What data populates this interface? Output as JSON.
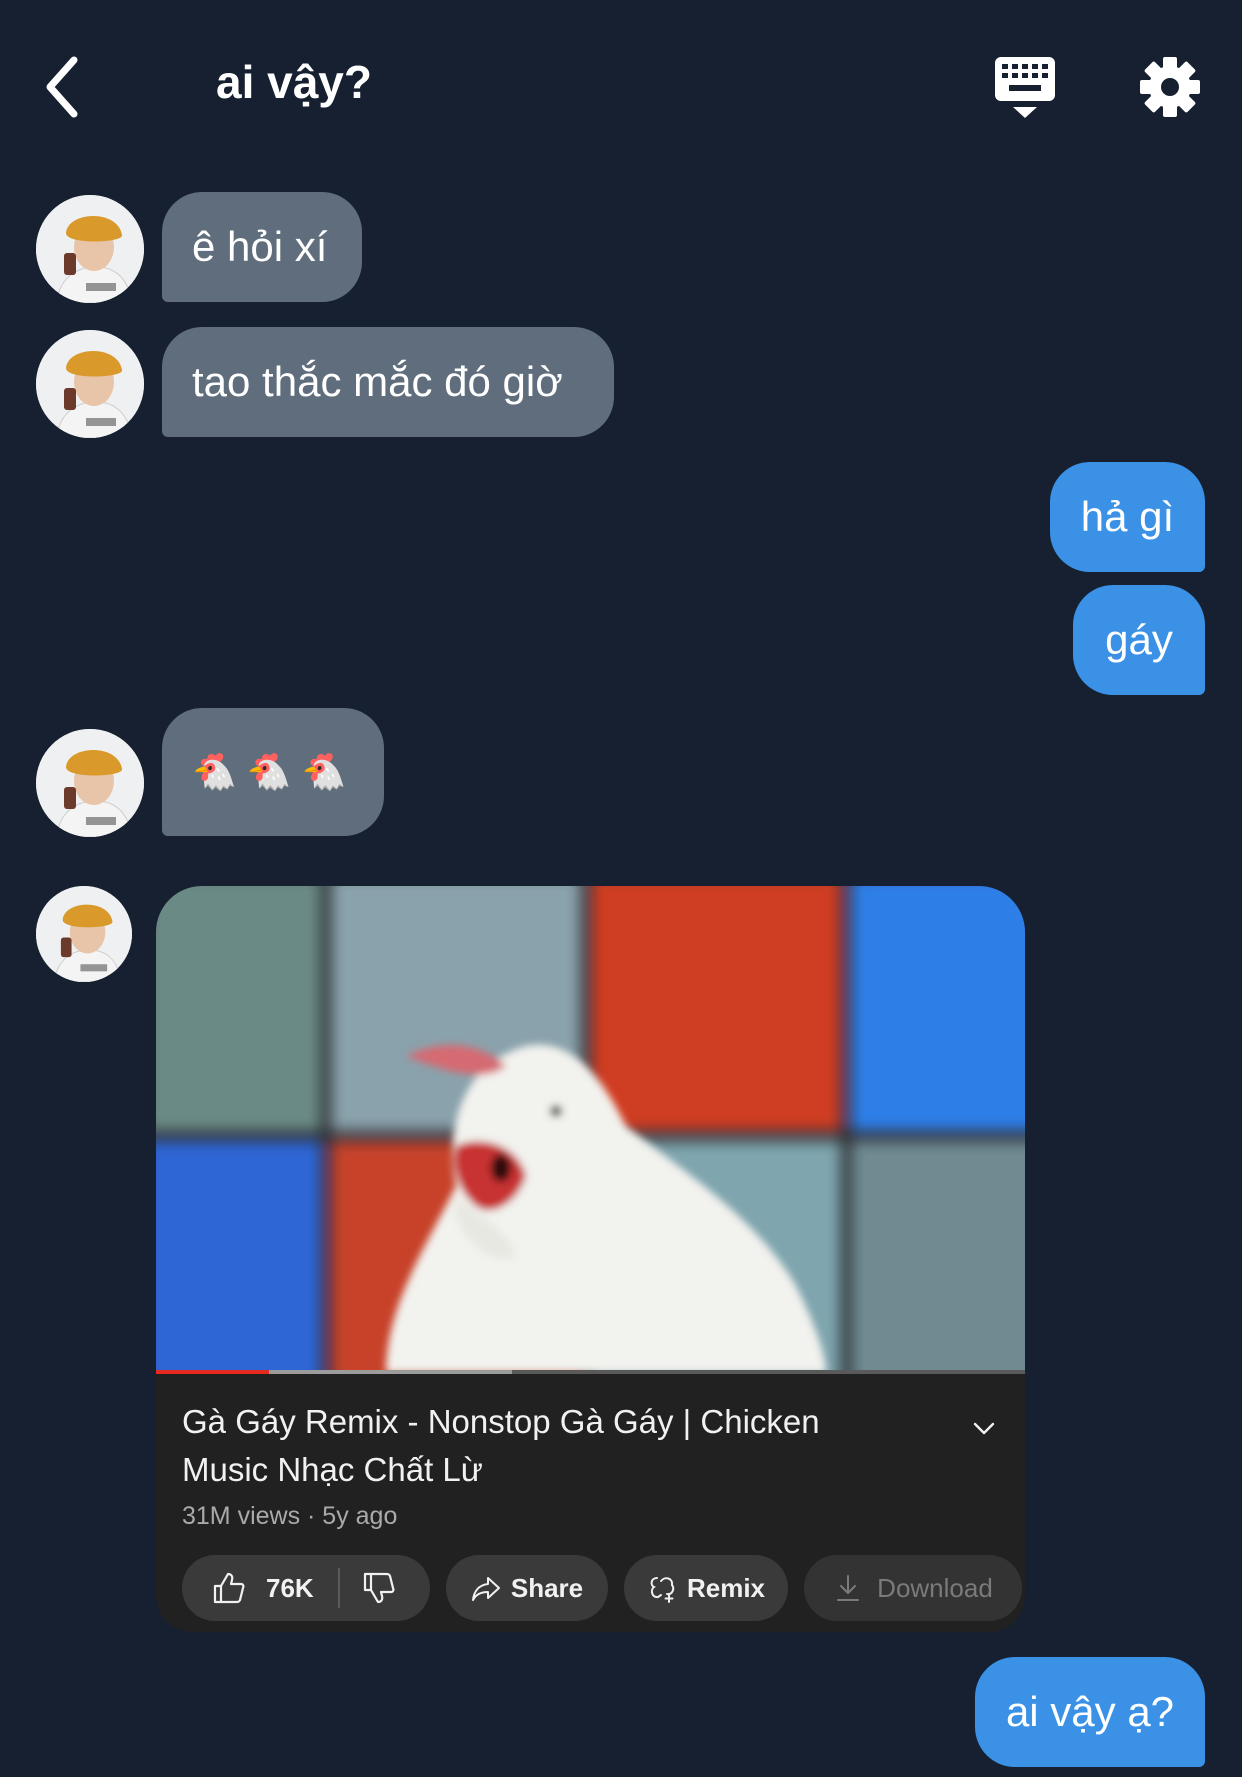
{
  "header": {
    "title": "ai vậy?"
  },
  "messages": [
    {
      "side": "in",
      "text": "ê hỏi xí"
    },
    {
      "side": "in",
      "text": "tao thắc mắc đó giờ"
    },
    {
      "side": "out",
      "text": "hả gì"
    },
    {
      "side": "out",
      "text": "gáy"
    },
    {
      "side": "in",
      "text": "🐔 🐔 🐔"
    },
    {
      "side": "in",
      "type": "video"
    },
    {
      "side": "out",
      "text": "ai vậy ạ?"
    }
  ],
  "video": {
    "title": "Gà Gáy Remix - Nonstop Gà Gáy | Chicken Music Nhạc Chất Lừ",
    "meta": "31M views · 5y ago",
    "likes": "76K",
    "share_label": "Share",
    "remix_label": "Remix",
    "download_label": "Download",
    "progress_played": 0.13,
    "progress_buffered": 0.41
  },
  "colors": {
    "background": "#172030",
    "incoming_bubble": "#5f6d7c",
    "outgoing_bubble": "#3a91e6",
    "video_card": "#212121"
  },
  "icons": [
    "back-chevron-icon",
    "keyboard-icon",
    "gear-icon",
    "thumbs-up-icon",
    "thumbs-down-icon",
    "share-icon",
    "remix-icon",
    "download-icon",
    "chevron-down-icon"
  ]
}
